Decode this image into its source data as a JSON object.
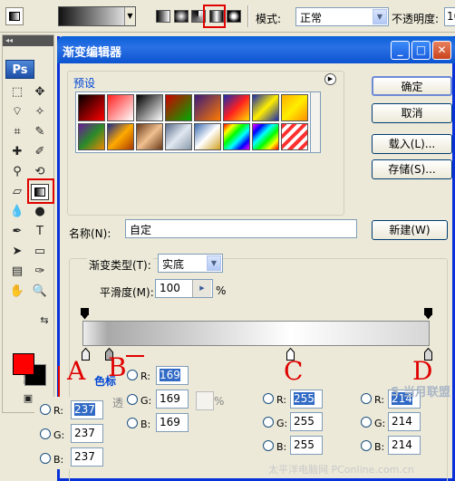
{
  "options_bar": {
    "mode_label": "模式:",
    "mode_value": "正常",
    "opacity_label": "不透明度:",
    "opacity_value": "10"
  },
  "toolbox": {
    "logo": "Ps",
    "grip": "◂◂",
    "tools": [
      {
        "name": "marquee-icon",
        "glyph": "⬚"
      },
      {
        "name": "move-icon",
        "glyph": "✥"
      },
      {
        "name": "lasso-icon",
        "glyph": "⌔"
      },
      {
        "name": "magic-wand-icon",
        "glyph": "✧"
      },
      {
        "name": "crop-icon",
        "glyph": "⌗"
      },
      {
        "name": "slice-icon",
        "glyph": "✎"
      },
      {
        "name": "healing-brush-icon",
        "glyph": "✚"
      },
      {
        "name": "brush-icon",
        "glyph": "✐"
      },
      {
        "name": "clone-stamp-icon",
        "glyph": "⚲"
      },
      {
        "name": "history-brush-icon",
        "glyph": "⟲"
      },
      {
        "name": "eraser-icon",
        "glyph": "▱"
      },
      {
        "name": "blur-icon",
        "glyph": "💧"
      },
      {
        "name": "dodge-icon",
        "glyph": "●"
      },
      {
        "name": "pen-icon",
        "glyph": "✒"
      },
      {
        "name": "type-icon",
        "glyph": "T"
      },
      {
        "name": "path-selection-icon",
        "glyph": "➤"
      },
      {
        "name": "shape-icon",
        "glyph": "▭"
      },
      {
        "name": "notes-icon",
        "glyph": "▤"
      },
      {
        "name": "eyedropper-icon",
        "glyph": "✑"
      },
      {
        "name": "hand-icon",
        "glyph": "✋"
      },
      {
        "name": "zoom-icon",
        "glyph": "🔍"
      },
      {
        "name": "swap-colors-icon",
        "glyph": "⇆"
      },
      {
        "name": "quick-mask-icon",
        "glyph": "◙"
      },
      {
        "name": "screen-mode-icon",
        "glyph": "▣"
      }
    ],
    "fg_color": "#ff0000",
    "bg_color": "#000000"
  },
  "dialog": {
    "title": "渐变编辑器",
    "presets_label": "预设",
    "buttons": {
      "ok": "确定",
      "cancel": "取消",
      "load": "载入(L)...",
      "save": "存储(S)...",
      "new": "新建(W)"
    },
    "name_label": "名称(N):",
    "name_value": "自定",
    "gradient_type_label": "渐变类型(T):",
    "gradient_type_value": "实底",
    "smoothness_label": "平滑度(M):",
    "smoothness_value": "100",
    "smoothness_unit": "%",
    "color_label": "色标",
    "opacity_partial_label": "透",
    "pct_partial": "%"
  },
  "annotations": {
    "A": "A",
    "B": "B",
    "C": "C",
    "D": "D"
  },
  "stops": {
    "A": {
      "r": "237",
      "g": "237",
      "b": "237"
    },
    "B": {
      "r": "169",
      "g": "169",
      "b": "169"
    },
    "C": {
      "r": "255",
      "g": "255",
      "b": "255"
    },
    "D": {
      "r": "214",
      "g": "214",
      "b": "214"
    }
  },
  "rgb_labels": {
    "r": "R:",
    "g": "G:",
    "b": "B:"
  },
  "watermark": "太平洋电脑网 PConline.com.cn",
  "logo_mark": "S 当月联盟"
}
